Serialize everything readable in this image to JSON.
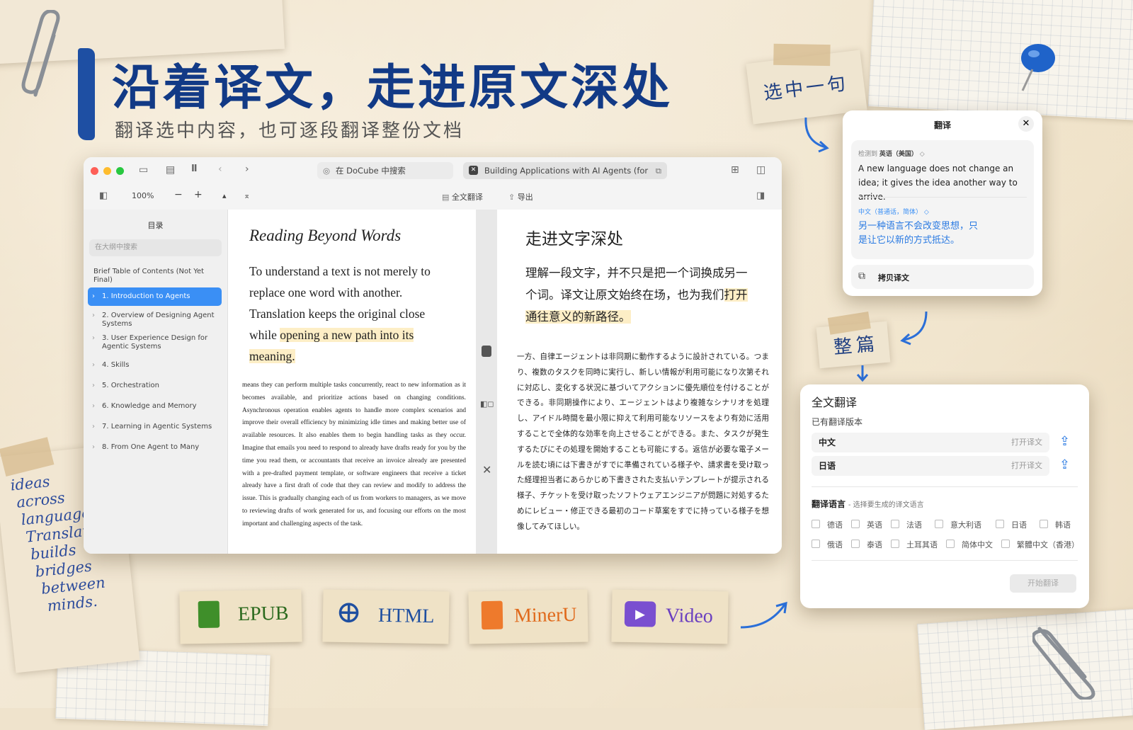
{
  "headline": "沿着译文，走进原文深处",
  "subhead": "翻译选中内容，也可逐段翻译整份文档",
  "window": {
    "tabs": [
      "在 DoCube 中搜索",
      "Building Applications with AI Agents (for"
    ],
    "zoom": "100%",
    "minus": "−",
    "plus": "+",
    "translate_all_btn": "全文翻译",
    "export_btn": "导出"
  },
  "sidebar": {
    "title": "目录",
    "search_placeholder": "在大纲中搜索",
    "header_item": "Brief Table of Contents (Not Yet Final)",
    "items": [
      {
        "label": "1. Introduction to Agents",
        "active": true
      },
      {
        "label": "2. Overview of Designing Agent Systems"
      },
      {
        "label": "3. User Experience Design for Agentic Systems"
      },
      {
        "label": "4. Skills"
      },
      {
        "label": "5. Orchestration"
      },
      {
        "label": "6. Knowledge and Memory"
      },
      {
        "label": "7. Learning in Agentic Systems"
      },
      {
        "label": "8. From One Agent to Many"
      }
    ]
  },
  "left_doc": {
    "title": "Reading Beyond Words",
    "para_plain": "To understand a text is not merely to replace one word with another. Translation keeps the original close while ",
    "para_highlight": "opening a new path into its meaning.",
    "body": "means they can perform multiple tasks concurrently, react to new information as it becomes available, and prioritize actions based on changing conditions. Asynchronous operation enables agents to handle more complex scenarios and improve their overall efficiency by minimizing idle times and making better use of available resources. It also enables them to begin handling tasks as they occur. Imagine that emails you need to respond to already have drafts ready for you by the time you read them, or accountants that receive an invoice already are presented with a pre-drafted payment template, or software engineers that receive a ticket already have a first draft of code that they can review and modify to address the issue. This is gradually changing each of us from workers to managers, as we move to reviewing drafts of work generated for us, and focusing our efforts on the most important and challenging aspects of the task."
  },
  "right_doc": {
    "title": "走进文字深处",
    "para_plain": "理解一段文字，并不只是把一个词换成另一个词。译文让原文始终在场，也为我们",
    "para_highlight": "打开通往意义的新路径。",
    "body": "一方、自律エージェントは非同期に動作するように設計されている。つまり、複数のタスクを同時に実行し、新しい情報が利用可能になり次第それに対応し、変化する状況に基づいてアクションに優先順位を付けることができる。非同期操作により、エージェントはより複雑なシナリオを処理し、アイドル時間を最小限に抑えて利用可能なリソースをより有効に活用することで全体的な効率を向上させることができる。また、タスクが発生するたびにその処理を開始することも可能にする。返信が必要な電子メールを読む頃には下書きがすでに準備されている様子や、請求書を受け取った経理担当者にあらかじめ下書きされた支払いテンプレートが提示される様子、チケットを受け取ったソフトウェアエンジニアが問題に対処するためにレビュー・修正できる最初のコード草案をすでに持っている様子を想像してみてほしい。"
  },
  "note_select": "选中一句",
  "note_whole": "整篇",
  "popup": {
    "title": "翻译",
    "detected_label": "检测到",
    "detected_lang": "英语（美国）",
    "source_text": "A new language does not change an idea; it gives the idea another way to arrive.",
    "target_lang": "中文（普通话，简体）",
    "target_text": "另一种语言不会改变思想，只是让它以新的方式抵达。",
    "copy_btn": "拷贝译文"
  },
  "panel": {
    "title": "全文翻译",
    "existing_label": "已有翻译版本",
    "versions": [
      {
        "lang": "中文",
        "action": "打开译文"
      },
      {
        "lang": "日语",
        "action": "打开译文"
      }
    ],
    "lang_label": "翻译语言",
    "lang_hint": "- 选择要生成的译文语言",
    "languages_row1": [
      "德语",
      "英语",
      "法语",
      "意大利语",
      "日语",
      "韩语"
    ],
    "languages_row2": [
      "俄语",
      "泰语",
      "土耳其语",
      "简体中文",
      "繁體中文（香港）"
    ],
    "start_btn": "开始翻译"
  },
  "formats": [
    "EPUB",
    "HTML",
    "MinerU",
    "Video"
  ],
  "handwriting": [
    "ideas",
    "across",
    "language.",
    "Translation",
    "builds",
    "bridges",
    "between",
    "minds."
  ],
  "colors": {
    "headline": "#123a86",
    "accent": "#3a8ff5",
    "highlight": "#fdeec6"
  }
}
